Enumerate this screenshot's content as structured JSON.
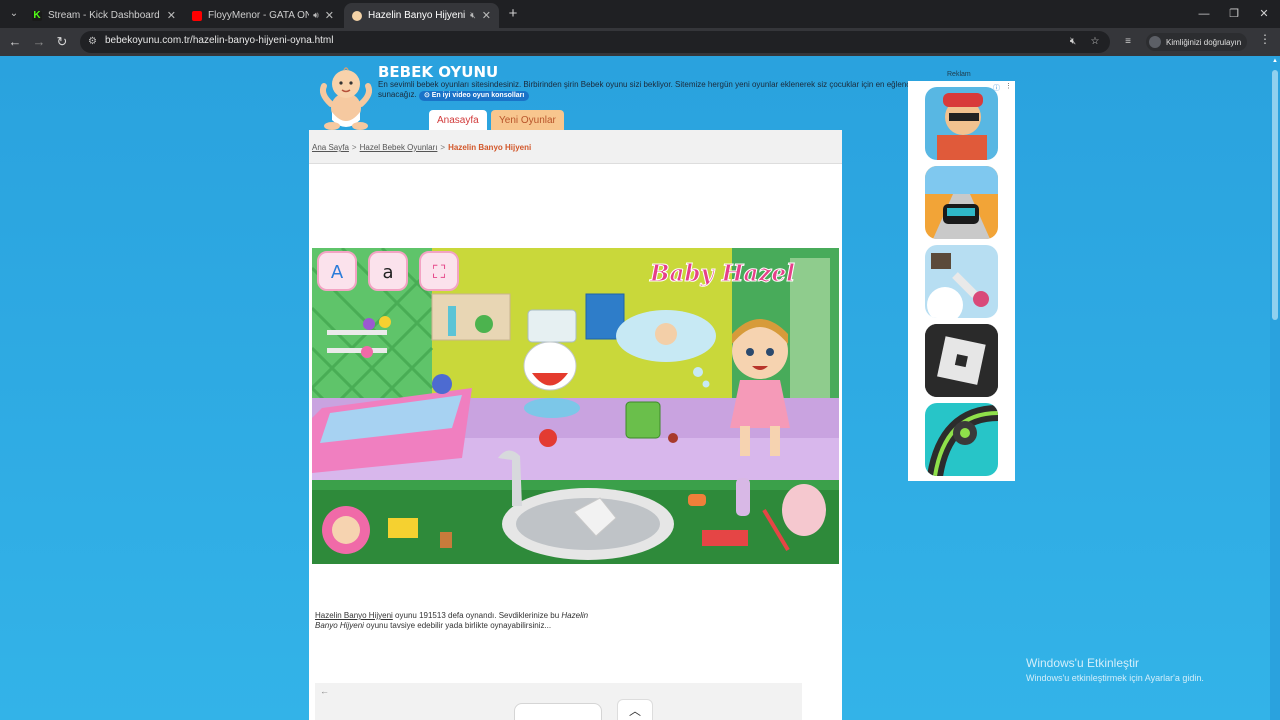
{
  "browser": {
    "tabs": [
      {
        "title": "Stream - Kick Dashboard",
        "icon": "kick-logo-icon",
        "color": "#53fc18"
      },
      {
        "title": "FloyyMenor - GATA ONLY (Of",
        "icon": "youtube-logo-icon",
        "color": "#ff0000"
      },
      {
        "title": "Hazelin Banyo Hijyeni",
        "icon": "baby-face-icon",
        "color": "#f3d2a6"
      }
    ],
    "url": "bebekoyunu.com.tr/hazelin-banyo-hijyeni-oyna.html",
    "profile_label": "Kimliğinizi doğrulayın"
  },
  "site": {
    "brand": "BEBEK OYUNU",
    "tagline": "En sevimli bebek oyunları sitesindesiniz. Birbirinden şirin Bebek oyunu sizi bekliyor. Sitemize hergün yeni oyunlar eklenerek siz çocuklar için en eğlenceli oyunları sunacağız.",
    "console_link": "⊙ En iyi video oyun konsolları",
    "nav": {
      "home": "Anasayfa",
      "new": "Yeni Oyunlar"
    }
  },
  "breadcrumb": {
    "home": "Ana Sayfa",
    "category": "Hazel Bebek Oyunları",
    "current": "Hazelin Banyo Hijyeni"
  },
  "game": {
    "logo_text": "Baby Hazel"
  },
  "playinfo": {
    "game_link": "Hazelin Banyo Hijyeni",
    "text1": " oyunu 191513 defa oynandı. Sevdiklerinize bu ",
    "game_italic": "Hazelin Banyo Hijyeni",
    "text2": " oyunu tavsiye edebilir yada birlikte oynayabilirsiniz..."
  },
  "ad": {
    "label": "Reklam",
    "apps": [
      "subway-surfers-app-icon",
      "racing-car-app-icon",
      "ragdoll-app-icon",
      "roblox-app-icon",
      "tube-ball-app-icon"
    ]
  },
  "windows": {
    "activation_title": "Windows'u Etkinleştir",
    "activation_text": "Windows'u etkinleştirmek için Ayarlar'a gidin."
  }
}
